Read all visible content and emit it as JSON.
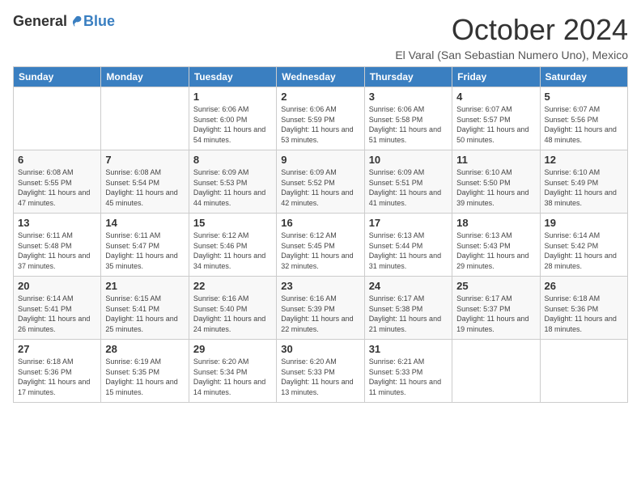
{
  "header": {
    "logo_general": "General",
    "logo_blue": "Blue",
    "month_title": "October 2024",
    "location": "El Varal (San Sebastian Numero Uno), Mexico"
  },
  "weekdays": [
    "Sunday",
    "Monday",
    "Tuesday",
    "Wednesday",
    "Thursday",
    "Friday",
    "Saturday"
  ],
  "weeks": [
    [
      {
        "day": "",
        "info": ""
      },
      {
        "day": "",
        "info": ""
      },
      {
        "day": "1",
        "info": "Sunrise: 6:06 AM\nSunset: 6:00 PM\nDaylight: 11 hours and 54 minutes."
      },
      {
        "day": "2",
        "info": "Sunrise: 6:06 AM\nSunset: 5:59 PM\nDaylight: 11 hours and 53 minutes."
      },
      {
        "day": "3",
        "info": "Sunrise: 6:06 AM\nSunset: 5:58 PM\nDaylight: 11 hours and 51 minutes."
      },
      {
        "day": "4",
        "info": "Sunrise: 6:07 AM\nSunset: 5:57 PM\nDaylight: 11 hours and 50 minutes."
      },
      {
        "day": "5",
        "info": "Sunrise: 6:07 AM\nSunset: 5:56 PM\nDaylight: 11 hours and 48 minutes."
      }
    ],
    [
      {
        "day": "6",
        "info": "Sunrise: 6:08 AM\nSunset: 5:55 PM\nDaylight: 11 hours and 47 minutes."
      },
      {
        "day": "7",
        "info": "Sunrise: 6:08 AM\nSunset: 5:54 PM\nDaylight: 11 hours and 45 minutes."
      },
      {
        "day": "8",
        "info": "Sunrise: 6:09 AM\nSunset: 5:53 PM\nDaylight: 11 hours and 44 minutes."
      },
      {
        "day": "9",
        "info": "Sunrise: 6:09 AM\nSunset: 5:52 PM\nDaylight: 11 hours and 42 minutes."
      },
      {
        "day": "10",
        "info": "Sunrise: 6:09 AM\nSunset: 5:51 PM\nDaylight: 11 hours and 41 minutes."
      },
      {
        "day": "11",
        "info": "Sunrise: 6:10 AM\nSunset: 5:50 PM\nDaylight: 11 hours and 39 minutes."
      },
      {
        "day": "12",
        "info": "Sunrise: 6:10 AM\nSunset: 5:49 PM\nDaylight: 11 hours and 38 minutes."
      }
    ],
    [
      {
        "day": "13",
        "info": "Sunrise: 6:11 AM\nSunset: 5:48 PM\nDaylight: 11 hours and 37 minutes."
      },
      {
        "day": "14",
        "info": "Sunrise: 6:11 AM\nSunset: 5:47 PM\nDaylight: 11 hours and 35 minutes."
      },
      {
        "day": "15",
        "info": "Sunrise: 6:12 AM\nSunset: 5:46 PM\nDaylight: 11 hours and 34 minutes."
      },
      {
        "day": "16",
        "info": "Sunrise: 6:12 AM\nSunset: 5:45 PM\nDaylight: 11 hours and 32 minutes."
      },
      {
        "day": "17",
        "info": "Sunrise: 6:13 AM\nSunset: 5:44 PM\nDaylight: 11 hours and 31 minutes."
      },
      {
        "day": "18",
        "info": "Sunrise: 6:13 AM\nSunset: 5:43 PM\nDaylight: 11 hours and 29 minutes."
      },
      {
        "day": "19",
        "info": "Sunrise: 6:14 AM\nSunset: 5:42 PM\nDaylight: 11 hours and 28 minutes."
      }
    ],
    [
      {
        "day": "20",
        "info": "Sunrise: 6:14 AM\nSunset: 5:41 PM\nDaylight: 11 hours and 26 minutes."
      },
      {
        "day": "21",
        "info": "Sunrise: 6:15 AM\nSunset: 5:41 PM\nDaylight: 11 hours and 25 minutes."
      },
      {
        "day": "22",
        "info": "Sunrise: 6:16 AM\nSunset: 5:40 PM\nDaylight: 11 hours and 24 minutes."
      },
      {
        "day": "23",
        "info": "Sunrise: 6:16 AM\nSunset: 5:39 PM\nDaylight: 11 hours and 22 minutes."
      },
      {
        "day": "24",
        "info": "Sunrise: 6:17 AM\nSunset: 5:38 PM\nDaylight: 11 hours and 21 minutes."
      },
      {
        "day": "25",
        "info": "Sunrise: 6:17 AM\nSunset: 5:37 PM\nDaylight: 11 hours and 19 minutes."
      },
      {
        "day": "26",
        "info": "Sunrise: 6:18 AM\nSunset: 5:36 PM\nDaylight: 11 hours and 18 minutes."
      }
    ],
    [
      {
        "day": "27",
        "info": "Sunrise: 6:18 AM\nSunset: 5:36 PM\nDaylight: 11 hours and 17 minutes."
      },
      {
        "day": "28",
        "info": "Sunrise: 6:19 AM\nSunset: 5:35 PM\nDaylight: 11 hours and 15 minutes."
      },
      {
        "day": "29",
        "info": "Sunrise: 6:20 AM\nSunset: 5:34 PM\nDaylight: 11 hours and 14 minutes."
      },
      {
        "day": "30",
        "info": "Sunrise: 6:20 AM\nSunset: 5:33 PM\nDaylight: 11 hours and 13 minutes."
      },
      {
        "day": "31",
        "info": "Sunrise: 6:21 AM\nSunset: 5:33 PM\nDaylight: 11 hours and 11 minutes."
      },
      {
        "day": "",
        "info": ""
      },
      {
        "day": "",
        "info": ""
      }
    ]
  ]
}
